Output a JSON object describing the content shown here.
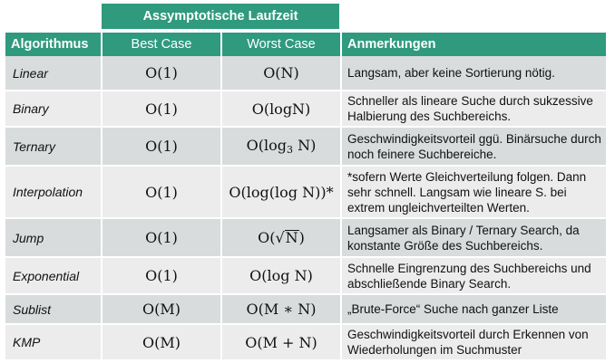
{
  "header": {
    "group_label": "Assymptotische Laufzeit",
    "col_algorithm": "Algorithmus",
    "col_best": "Best Case",
    "col_worst": "Worst Case",
    "col_notes": "Anmerkungen"
  },
  "rows": [
    {
      "name": "Linear",
      "best": "O(1)",
      "worst": "O(N)",
      "note": "Langsam, aber keine Sortierung nötig."
    },
    {
      "name": "Binary",
      "best": "O(1)",
      "worst": "O(logN)",
      "note": "Schneller als lineare Suche durch sukzessive Halbierung des Suchbereichs."
    },
    {
      "name": "Ternary",
      "best": "O(1)",
      "worst_pre": "O(log",
      "worst_sub": "3",
      "worst_post": " N)",
      "note": "Geschwindigkeitsvorteil ggü. Binärsuche durch noch feinere Suchbereiche."
    },
    {
      "name": "Interpolation",
      "best": "O(1)",
      "worst": "O(log(log N))*",
      "note": "*sofern Werte Gleichverteilung folgen. Dann sehr schnell. Langsam wie lineare S. bei extrem ungleichverteilten Werten."
    },
    {
      "name": "Jump",
      "best": "O(1)",
      "worst_pre": "O(",
      "worst_root": "N",
      "worst_post": ")",
      "note": "Langsamer als Binary / Ternary Search, da konstante Größe des Suchbereichs."
    },
    {
      "name": "Exponential",
      "best": "O(1)",
      "worst": "O(log N)",
      "note": "Schnelle Eingrenzung des Suchbereichs und abschließende Binary Search."
    },
    {
      "name": "Sublist",
      "best": "O(M)",
      "worst": "O(M ∗ N)",
      "note": "„Brute-Force“ Suche nach ganzer Liste"
    },
    {
      "name": "KMP",
      "best": "O(M)",
      "worst": "O(M + N)",
      "note": "Geschwindigkeitsvorteil durch Erkennen von Wiederholungen im Suchmuster"
    }
  ]
}
